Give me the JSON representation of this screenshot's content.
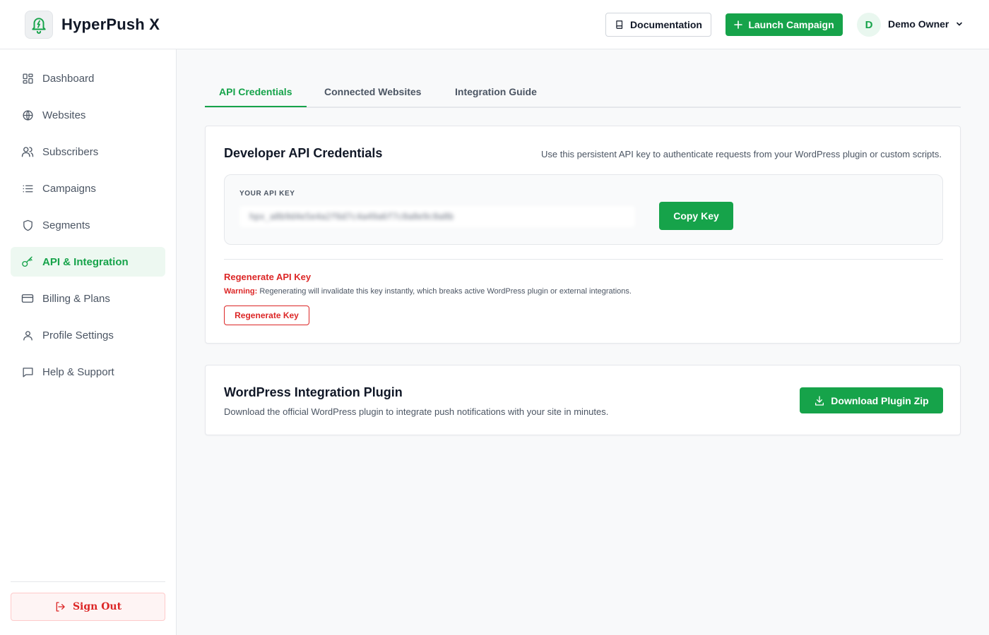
{
  "app": {
    "name": "HyperPush X"
  },
  "header": {
    "documentation_label": "Documentation",
    "launch_label": "Launch Campaign",
    "user_initial": "D",
    "user_name": "Demo Owner"
  },
  "sidebar": {
    "items": [
      {
        "label": "Dashboard",
        "icon": "grid-icon"
      },
      {
        "label": "Websites",
        "icon": "globe-icon"
      },
      {
        "label": "Subscribers",
        "icon": "users-icon"
      },
      {
        "label": "Campaigns",
        "icon": "list-icon"
      },
      {
        "label": "Segments",
        "icon": "shield-icon"
      },
      {
        "label": "API & Integration",
        "icon": "key-icon",
        "active": true
      },
      {
        "label": "Billing & Plans",
        "icon": "credit-card-icon"
      },
      {
        "label": "Profile Settings",
        "icon": "user-icon"
      },
      {
        "label": "Help & Support",
        "icon": "message-icon"
      }
    ],
    "sign_out_label": "Sign Out"
  },
  "tabs": [
    {
      "label": "API Credentials",
      "active": true
    },
    {
      "label": "Connected Websites"
    },
    {
      "label": "Integration Guide"
    }
  ],
  "credentials": {
    "title": "Developer API Credentials",
    "description": "Use this persistent API key to authenticate requests from your WordPress plugin or custom scripts.",
    "key_label": "YOUR API KEY",
    "key_value": "hpx_a8b9d4e5e4a2f6d7c4a49a6f7c0a8e9c0a8b",
    "copy_label": "Copy Key",
    "regenerate_title": "Regenerate API Key",
    "warning_prefix": "Warning:",
    "warning_text": "Regenerating will invalidate this key instantly, which breaks active WordPress plugin or external integrations.",
    "regenerate_button": "Regenerate Key"
  },
  "plugin": {
    "title": "WordPress Integration Plugin",
    "description": "Download the official WordPress plugin to integrate push notifications with your site in minutes.",
    "download_label": "Download Plugin Zip"
  },
  "colors": {
    "accent": "#16a34a",
    "danger": "#dc2626",
    "active_bg": "#edf8f1"
  }
}
